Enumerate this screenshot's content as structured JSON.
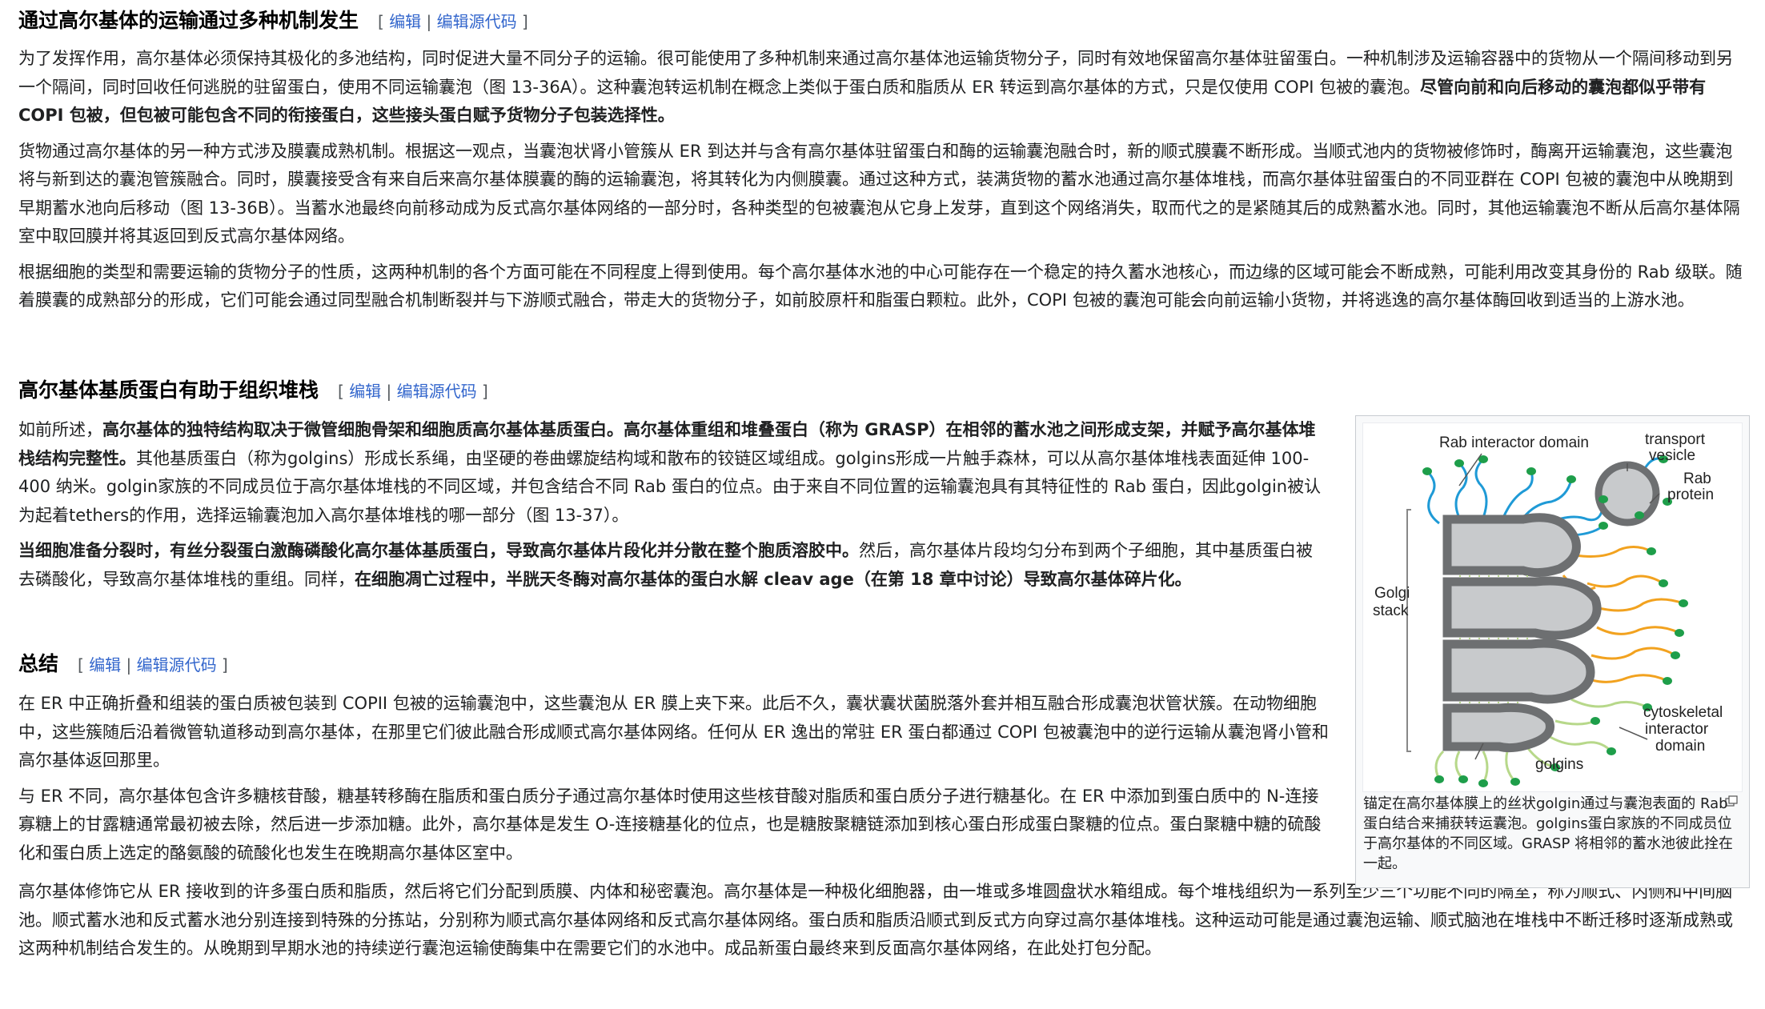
{
  "sections": [
    {
      "heading": "通过高尔基体的运输通过多种机制发生",
      "edit_label": "编辑",
      "edit_source_label": "编辑源代码",
      "paragraphs": [
        {
          "parts": [
            {
              "t": "为了发挥作用，高尔基体必须保持其极化的多池结构，同时促进大量不同分子的运输。很可能使用了多种机制来通过高尔基体池运输货物分子，同时有效地保留高尔基体驻留蛋白。一种机制涉及运输容器中的货物从一个隔间移动到另一个隔间，同时回收任何逃脱的驻留蛋白，使用不同运输囊泡（图 13-36A）。这种囊泡转运机制在概念上类似于蛋白质和脂质从 ER 转运到高尔基体的方式，只是仅使用 COPI 包被的囊泡。"
            },
            {
              "t": "尽管向前和向后移动的囊泡都似乎带有 COPI 包被，但包被可能包含不同的衔接蛋白，这些接头蛋白赋予货物分子包装选择性。",
              "b": true
            }
          ]
        },
        {
          "parts": [
            {
              "t": "货物通过高尔基体的另一种方式涉及膜囊成熟机制。根据这一观点，当囊泡状肾小管簇从 ER 到达并与含有高尔基体驻留蛋白和酶的运输囊泡融合时，新的顺式膜囊不断形成。当顺式池内的货物被修饰时，酶离开运输囊泡，这些囊泡将与新到达的囊泡管簇融合。同时，膜囊接受含有来自后来高尔基体膜囊的酶的运输囊泡，将其转化为内侧膜囊。通过这种方式，装满货物的蓄水池通过高尔基体堆栈，而高尔基体驻留蛋白的不同亚群在 COPI 包被的囊泡中从晚期到早期蓄水池向后移动（图 13-36B）。当蓄水池最终向前移动成为反式高尔基体网络的一部分时，各种类型的包被囊泡从它身上发芽，直到这个网络消失，取而代之的是紧随其后的成熟蓄水池。同时，其他运输囊泡不断从后高尔基体隔室中取回膜并将其返回到反式高尔基体网络。"
            }
          ]
        },
        {
          "parts": [
            {
              "t": "根据细胞的类型和需要运输的货物分子的性质，这两种机制的各个方面可能在不同程度上得到使用。每个高尔基体水池的中心可能存在一个稳定的持久蓄水池核心，而边缘的区域可能会不断成熟，可能利用改变其身份的 Rab 级联。随着膜囊的成熟部分的形成，它们可能会通过同型融合机制断裂并与下游顺式融合，带走大的货物分子，如前胶原杆和脂蛋白颗粒。此外，COPI 包被的囊泡可能会向前运输小货物，并将逃逸的高尔基体酶回收到适当的上游水池。"
            }
          ]
        }
      ]
    },
    {
      "heading": "高尔基体基质蛋白有助于组织堆栈",
      "edit_label": "编辑",
      "edit_source_label": "编辑源代码",
      "paragraphs": [
        {
          "parts": [
            {
              "t": "如前所述，"
            },
            {
              "t": "高尔基体的独特结构取决于微管细胞骨架和细胞质高尔基体基质蛋白。高尔基体重组和堆叠蛋白（称为 GRASP）在相邻的蓄水池之间形成支架，并赋予高尔基体堆栈结构完整性。",
              "b": true
            },
            {
              "t": "其他基质蛋白（称为golgins）形成长系绳，由坚硬的卷曲螺旋结构域和散布的铰链区域组成。golgins形成一片触手森林，可以从高尔基体堆栈表面延伸 100-400 纳米。golgin家族的不同成员位于高尔基体堆栈的不同区域，并包含结合不同 Rab 蛋白的位点。由于来自不同位置的运输囊泡具有其特征性的 Rab 蛋白，因此golgin被认为起着tethers的作用，选择运输囊泡加入高尔基体堆栈的哪一部分（图 13-37）。"
            }
          ]
        },
        {
          "parts": [
            {
              "t": "当细胞准备分裂时，有丝分裂蛋白激酶磷酸化高尔基体基质蛋白，导致高尔基体片段化并分散在整个胞质溶胶中。",
              "b": true
            },
            {
              "t": "然后，高尔基体片段均匀分布到两个子细胞，其中基质蛋白被去磷酸化，导致高尔基体堆栈的重组。同样，"
            },
            {
              "t": "在细胞凋亡过程中，半胱天冬酶对高尔基体的蛋白水解 cleav age（在第 18 章中讨论）导致高尔基体碎片化。",
              "b": true
            }
          ]
        }
      ]
    },
    {
      "heading": "总结",
      "edit_label": "编辑",
      "edit_source_label": "编辑源代码",
      "paragraphs": [
        {
          "parts": [
            {
              "t": "在 ER 中正确折叠和组装的蛋白质被包装到 COPII 包被的运输囊泡中，这些囊泡从 ER 膜上夹下来。此后不久，囊状囊状菌脱落外套并相互融合形成囊泡状管状簇。在动物细胞中，这些簇随后沿着微管轨道移动到高尔基体，在那里它们彼此融合形成顺式高尔基体网络。任何从 ER 逸出的常驻 ER 蛋白都通过 COPI 包被囊泡中的逆行运输从囊泡肾小管和高尔基体返回那里。"
            }
          ]
        },
        {
          "parts": [
            {
              "t": "与 ER 不同，高尔基体包含许多糖核苷酸，糖基转移酶在脂质和蛋白质分子通过高尔基体时使用这些核苷酸对脂质和蛋白质分子进行糖基化。在 ER 中添加到蛋白质中的 N-连接寡糖上的甘露糖通常最初被去除，然后进一步添加糖。此外，高尔基体是发生 O-连接糖基化的位点，也是糖胺聚糖链添加到核心蛋白形成蛋白聚糖的位点。蛋白聚糖中糖的硫酸化和蛋白质上选定的酪氨酸的硫酸化也发生在晚期高尔基体区室中。"
            }
          ]
        },
        {
          "parts": [
            {
              "t": "高尔基体修饰它从 ER 接收到的许多蛋白质和脂质，然后将它们分配到质膜、内体和秘密囊泡。高尔基体是一种极化细胞器，由一堆或多堆圆盘状水箱组成。每个堆栈组织为一系列至少三个功能不同的隔室，称为顺式、内侧和中间脑池。顺式蓄水池和反式蓄水池分别连接到特殊的分拣站，分别称为顺式高尔基体网络和反式高尔基体网络。蛋白质和脂质沿顺式到反式方向穿过高尔基体堆栈。这种运动可能是通过囊泡运输、顺式脑池在堆栈中不断迁移时逐渐成熟或这两种机制结合发生的。从晚期到早期水池的持续逆行囊泡运输使酶集中在需要它们的水池中。成品新蛋白最终来到反面高尔基体网络，在此处打包分配。"
            }
          ]
        }
      ]
    }
  ],
  "figure": {
    "labels": {
      "rab_interactor": "Rab interactor domain",
      "transport": "transport",
      "vesicle": "vesicle",
      "rab": "Rab",
      "protein": "protein",
      "golgi": "Golgi",
      "stack": "stack",
      "cytoskeletal": "cytoskeletal",
      "interactor": "interactor",
      "domain": "domain",
      "golgins": "golgins"
    },
    "caption": "锚定在高尔基体膜上的丝状golgin通过与囊泡表面的 Rab 蛋白结合来捕获转运囊泡。golgins蛋白家族的不同成员位于高尔基体的不同区域。GRASP 将相邻的蓄水池彼此拴在一起。"
  },
  "colors": {
    "link": "#3366cc",
    "membrane_fill": "#c8cacc",
    "membrane_stroke": "#6d6f71",
    "golgin_blue": "#1f9ad6",
    "golgin_orange": "#f2a21f",
    "golgin_green": "#b7d88a",
    "rab_green": "#1e9e4a"
  }
}
